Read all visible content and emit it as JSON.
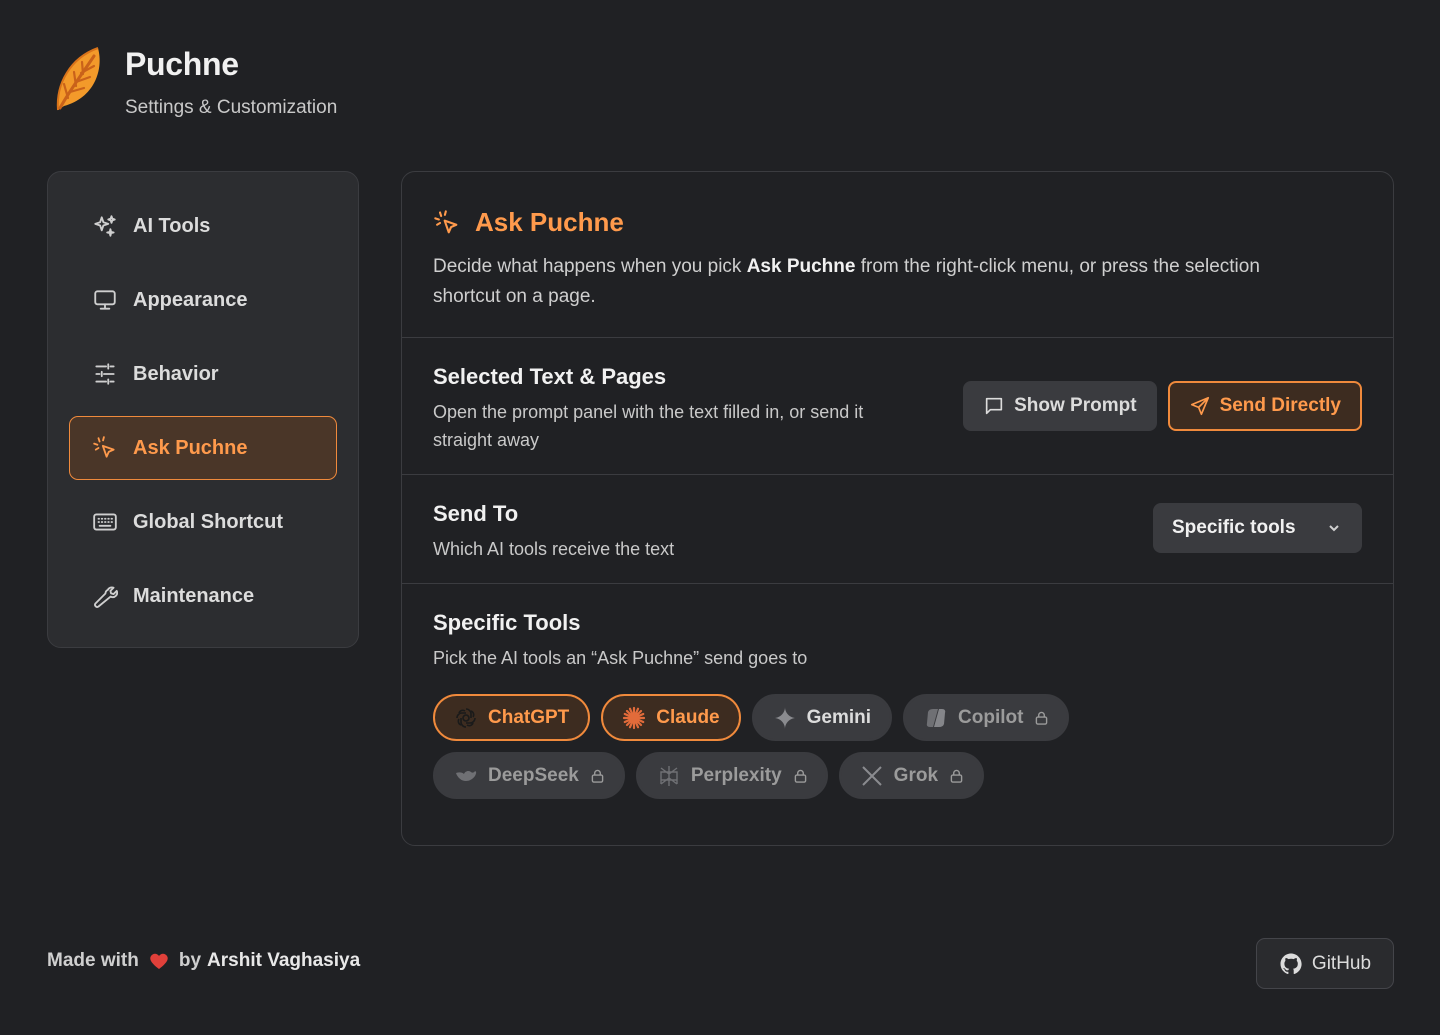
{
  "app": {
    "title": "Puchne",
    "subtitle": "Settings & Customization"
  },
  "sidebar": {
    "items": [
      {
        "label": "AI Tools",
        "icon": "sparkles-icon"
      },
      {
        "label": "Appearance",
        "icon": "monitor-icon"
      },
      {
        "label": "Behavior",
        "icon": "sliders-icon"
      },
      {
        "label": "Ask Puchne",
        "icon": "cursor-click-icon",
        "active": true
      },
      {
        "label": "Global Shortcut",
        "icon": "keyboard-icon"
      },
      {
        "label": "Maintenance",
        "icon": "wrench-icon"
      }
    ]
  },
  "main": {
    "title": "Ask Puchne",
    "desc_pre": "Decide what happens when you pick ",
    "desc_bold": "Ask Puchne",
    "desc_post": " from the right-click menu, or press the selection shortcut on a page.",
    "selected_text": {
      "title": "Selected Text & Pages",
      "desc": "Open the prompt panel with the text filled in, or send it straight away",
      "show_prompt": "Show Prompt",
      "send_directly": "Send Directly",
      "selected": "Send Directly"
    },
    "send_to": {
      "title": "Send To",
      "desc": "Which AI tools receive the text",
      "value": "Specific tools"
    },
    "specific_tools": {
      "title": "Specific Tools",
      "desc": "Pick the AI tools an “Ask Puchne” send goes to",
      "tools": [
        {
          "label": "ChatGPT",
          "selected": true,
          "locked": false
        },
        {
          "label": "Claude",
          "selected": true,
          "locked": false
        },
        {
          "label": "Gemini",
          "selected": false,
          "locked": false
        },
        {
          "label": "Copilot",
          "selected": false,
          "locked": true
        },
        {
          "label": "DeepSeek",
          "selected": false,
          "locked": true
        },
        {
          "label": "Perplexity",
          "selected": false,
          "locked": true
        },
        {
          "label": "Grok",
          "selected": false,
          "locked": true
        }
      ]
    }
  },
  "footer": {
    "made_with": "Made with",
    "by": "by",
    "author": "Arshit Vaghasiya",
    "github": "GitHub"
  },
  "colors": {
    "accent": "#ff9a4c",
    "background": "#202124",
    "card": "#2c2d30"
  }
}
